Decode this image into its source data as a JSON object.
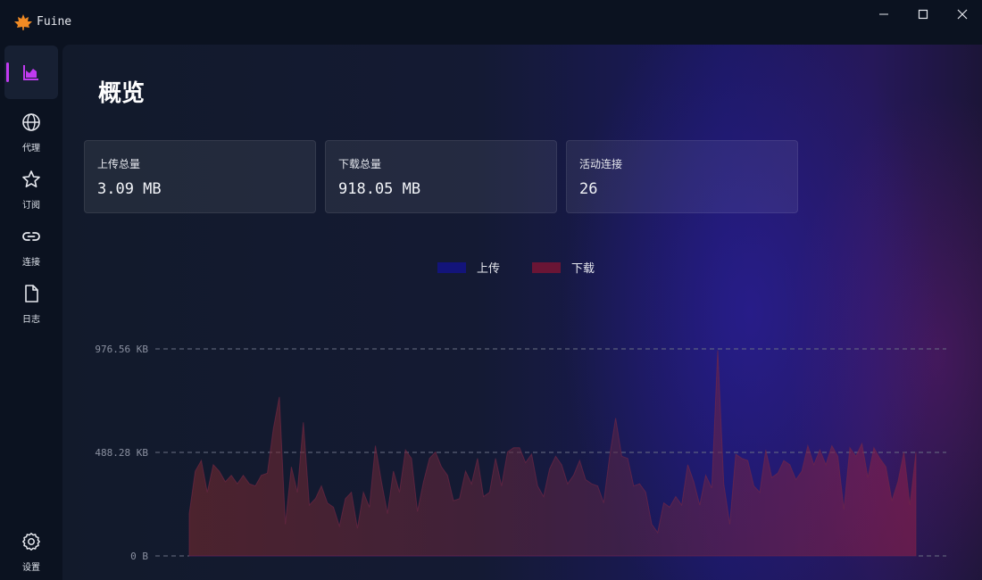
{
  "app": {
    "title": "Fuine"
  },
  "sidebar": {
    "items": [
      {
        "label": "",
        "icon": "chart-area-icon",
        "active": true
      },
      {
        "label": "代理",
        "icon": "globe-icon"
      },
      {
        "label": "订阅",
        "icon": "star-icon"
      },
      {
        "label": "连接",
        "icon": "link-icon"
      },
      {
        "label": "日志",
        "icon": "file-icon"
      },
      {
        "label": "设置",
        "icon": "gear-icon"
      }
    ]
  },
  "page": {
    "title": "概览"
  },
  "stats": [
    {
      "label": "上传总量",
      "value": "3.09 MB"
    },
    {
      "label": "下载总量",
      "value": "918.05 MB"
    },
    {
      "label": "活动连接",
      "value": "26"
    }
  ],
  "colors": {
    "accent": "#c13af0",
    "upload": "#13147a",
    "download": "#6a1535"
  },
  "chart_data": {
    "type": "area",
    "legend": {
      "position": "top-center"
    },
    "y_ticks": [
      "976.56 KB",
      "488.28 KB",
      "0 B"
    ],
    "ylim": [
      0,
      976.56
    ],
    "grid": true,
    "series": [
      {
        "name": "上传",
        "values": [
          0,
          0,
          0,
          0,
          0,
          0,
          0,
          0,
          0,
          0,
          0,
          0,
          0,
          0,
          0,
          0,
          0,
          0,
          0,
          0,
          0,
          0,
          0,
          0,
          0,
          0,
          0,
          0,
          0,
          0,
          0,
          0,
          0,
          0,
          0,
          0,
          0,
          0,
          0,
          0,
          0,
          0,
          0,
          0,
          0,
          0,
          0,
          0,
          0,
          0,
          0,
          0,
          0,
          0,
          0,
          0,
          0,
          0,
          0,
          0,
          0,
          0,
          0,
          0,
          0,
          0,
          0,
          0,
          0,
          0,
          0,
          0,
          0,
          0,
          0,
          0,
          0,
          0,
          0,
          0,
          0,
          0,
          0,
          0,
          0,
          0,
          0,
          0,
          0,
          0,
          0,
          0,
          0,
          0,
          0,
          0,
          0,
          0,
          0,
          0,
          0,
          0,
          0,
          0,
          0,
          0,
          0,
          0,
          0,
          0,
          0,
          0,
          0,
          0,
          0,
          0,
          0,
          0,
          0,
          0,
          0,
          0
        ]
      },
      {
        "name": "下载",
        "values": [
          200,
          400,
          450,
          300,
          430,
          400,
          350,
          380,
          340,
          380,
          340,
          330,
          380,
          390,
          600,
          750,
          150,
          420,
          300,
          630,
          240,
          270,
          330,
          250,
          230,
          140,
          270,
          300,
          130,
          300,
          230,
          520,
          350,
          200,
          400,
          300,
          500,
          460,
          210,
          350,
          460,
          490,
          420,
          380,
          260,
          270,
          400,
          340,
          460,
          280,
          300,
          460,
          330,
          490,
          510,
          510,
          440,
          480,
          330,
          280,
          410,
          470,
          430,
          340,
          380,
          450,
          360,
          340,
          330,
          250,
          470,
          650,
          470,
          460,
          330,
          340,
          300,
          150,
          110,
          250,
          230,
          280,
          240,
          430,
          350,
          240,
          380,
          320,
          970,
          340,
          150,
          480,
          460,
          450,
          330,
          300,
          500,
          370,
          390,
          450,
          430,
          360,
          400,
          520,
          430,
          500,
          430,
          520,
          470,
          220,
          510,
          470,
          530,
          370,
          510,
          460,
          420,
          260,
          350,
          490,
          240,
          490
        ]
      }
    ]
  }
}
